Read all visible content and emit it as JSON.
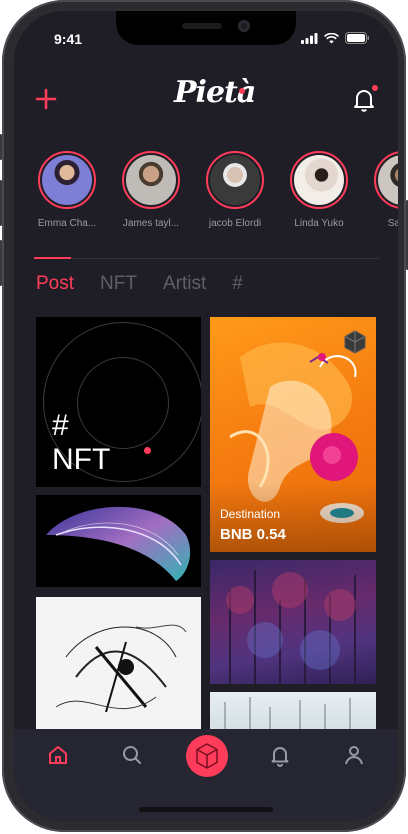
{
  "status_bar": {
    "time": "9:41"
  },
  "header": {
    "logo_text": "Pietà"
  },
  "stories": [
    {
      "name": "Emma Cha...",
      "avatar": "person-avatar"
    },
    {
      "name": "James tayl...",
      "avatar": "person-avatar"
    },
    {
      "name": "jacob Elordi",
      "avatar": "person-avatar"
    },
    {
      "name": "Linda Yuko",
      "avatar": "person-avatar"
    },
    {
      "name": "Sam H",
      "avatar": "person-avatar"
    }
  ],
  "tabs": [
    {
      "label": "Post",
      "active": true
    },
    {
      "label": "NFT",
      "active": false
    },
    {
      "label": "Artist",
      "active": false
    },
    {
      "label": "#",
      "active": false
    }
  ],
  "cards": {
    "nft_card": {
      "line1": "#",
      "line2": "NFT"
    },
    "featured": {
      "title": "Destination",
      "price": "BNB 0.54"
    }
  },
  "bottom_nav": [
    {
      "icon": "home-icon",
      "active": true
    },
    {
      "icon": "search-icon",
      "active": false
    },
    {
      "icon": "cube-icon",
      "active": false
    },
    {
      "icon": "bell-icon",
      "active": false
    },
    {
      "icon": "profile-icon",
      "active": false
    }
  ],
  "colors": {
    "accent": "#ff3d5a",
    "background": "#1f1e27",
    "nav_bar": "#252631"
  }
}
